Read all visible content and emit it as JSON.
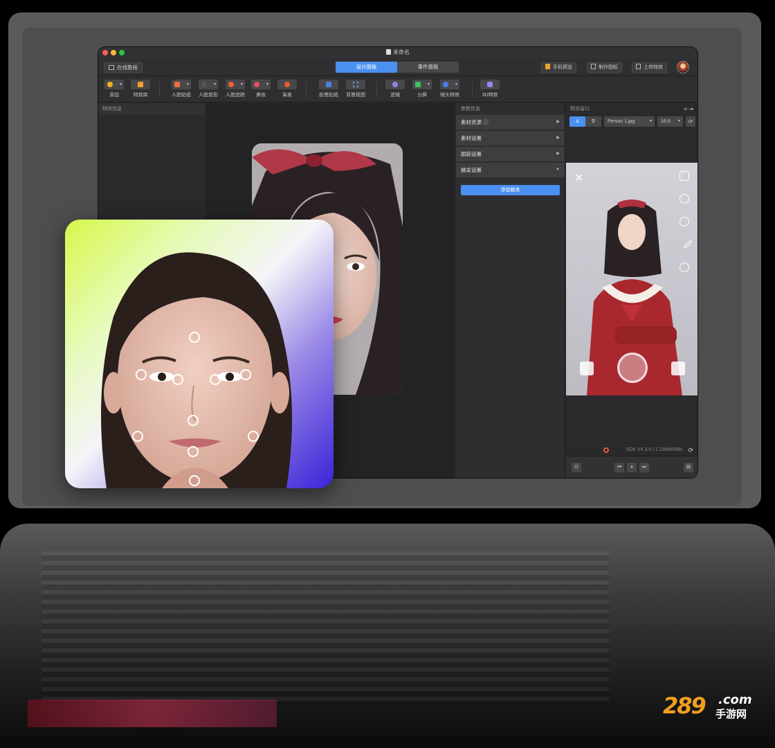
{
  "window": {
    "title": "未命名"
  },
  "topbar": {
    "tutorial_label": "在线教程",
    "tabs": [
      {
        "label": "设计面板",
        "active": true
      },
      {
        "label": "事件面板",
        "active": false
      }
    ],
    "phone_preview_label": "手机预览",
    "make_icon_label": "制作图标",
    "upload_label": "上传特效"
  },
  "toolbar": {
    "tools": [
      {
        "label": "添加",
        "icon": "add-icon"
      },
      {
        "label": "特效库",
        "icon": "library-icon"
      },
      {
        "label": "人脸贴纸",
        "icon": "face-sticker-icon"
      },
      {
        "label": "人脸变形",
        "icon": "face-deform-icon"
      },
      {
        "label": "人脸追踪",
        "icon": "face-track-icon"
      },
      {
        "label": "美妆",
        "icon": "makeup-icon"
      },
      {
        "label": "染发",
        "icon": "hair-dye-icon"
      },
      {
        "label": "前景贴纸",
        "icon": "foreground-sticker-icon"
      },
      {
        "label": "背景抠图",
        "icon": "background-matting-icon"
      },
      {
        "label": "滤镜",
        "icon": "filter-icon"
      },
      {
        "label": "分屏",
        "icon": "split-screen-icon"
      },
      {
        "label": "镜头特效",
        "icon": "lens-effect-icon"
      },
      {
        "label": "3D特效",
        "icon": "3d-effect-icon"
      }
    ]
  },
  "left_panel": {
    "header": "特效信息"
  },
  "params_panel": {
    "header": "参数信息",
    "sections": [
      {
        "label": "素材资源 ⓘ",
        "arrow": "▶"
      },
      {
        "label": "素材设置",
        "arrow": "▶"
      },
      {
        "label": "跟踪设置",
        "arrow": "▶"
      },
      {
        "label": "触发设置",
        "arrow": "▼"
      }
    ],
    "add_trigger_label": "添加触发"
  },
  "preview": {
    "header": "预览窗口",
    "file_select": "Person 1.jpg",
    "ratio_select": "16:9",
    "status_text": "SDK V4.3.0  |  1.23Mb/5Mb"
  },
  "watermark": {
    "num": "289",
    "com": ".com",
    "cn": "手游网"
  }
}
